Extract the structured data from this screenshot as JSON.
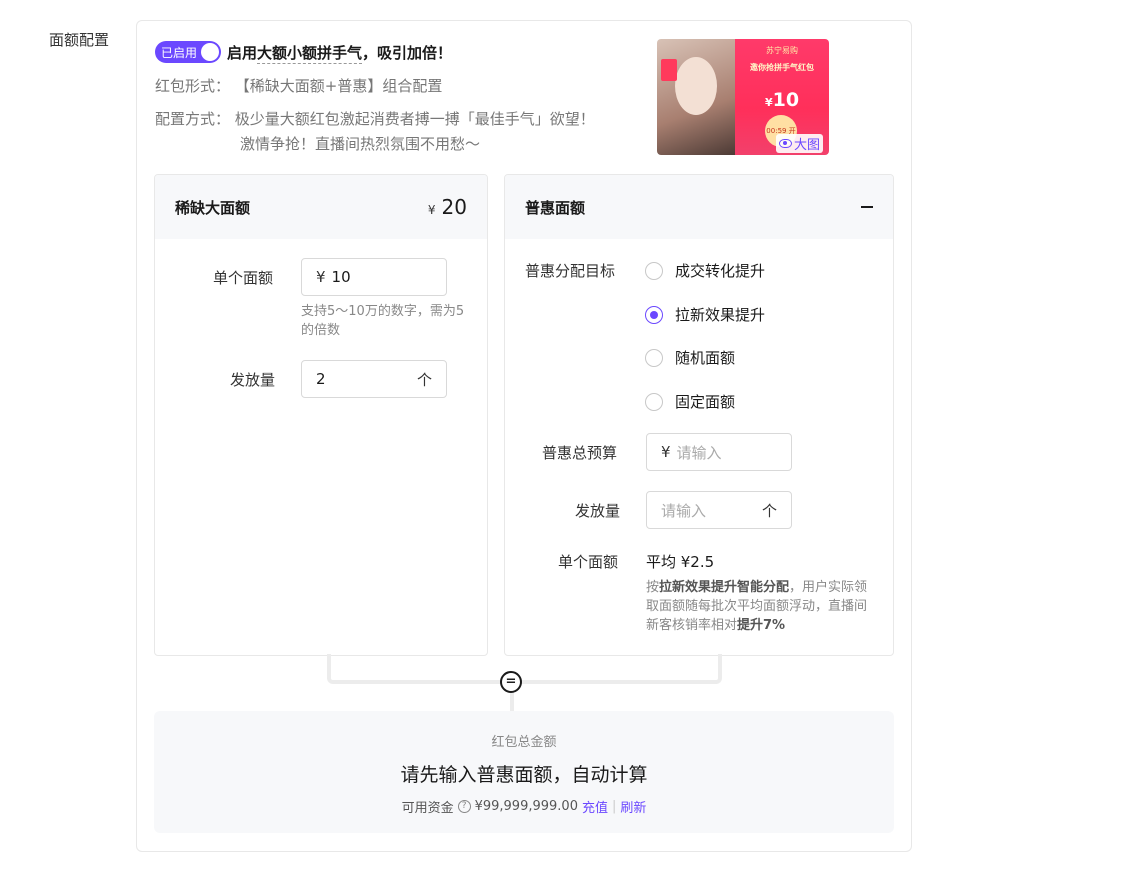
{
  "field_label": "面额配置",
  "header": {
    "toggle_label": "已启用",
    "title_prefix": "启用",
    "title_highlight": "大额小额拼手气",
    "title_suffix": "，吸引加倍！"
  },
  "info": {
    "form_label": "红包形式：",
    "form_value": "【稀缺大面额+普惠】组合配置",
    "method_label": "配置方式：",
    "method_value_1": "极少量大额红包激起消费者搏一搏「最佳手气」欲望！",
    "method_value_2": "激情争抢！直播间热烈氛围不用愁～"
  },
  "preview": {
    "brand": "苏宁易购",
    "banner": "邀你抢拼手气红包",
    "amount_currency": "¥",
    "amount": "10",
    "button": "00:59 开抢",
    "big_label": "大图"
  },
  "scarce": {
    "title": "稀缺大面额",
    "currency": "¥",
    "total": "20",
    "single_label": "单个面额",
    "single_currency": "¥",
    "single_value": "10",
    "hint": "支持5～10万的数字，需为5的倍数",
    "count_label": "发放量",
    "count_value": "2",
    "count_unit": "个"
  },
  "inclusive": {
    "title": "普惠面额",
    "goal_label": "普惠分配目标",
    "options": [
      {
        "label": "成交转化提升",
        "selected": false
      },
      {
        "label": "拉新效果提升",
        "selected": true
      },
      {
        "label": "随机面额",
        "selected": false
      },
      {
        "label": "固定面额",
        "selected": false
      }
    ],
    "budget_label": "普惠总预算",
    "budget_currency": "¥",
    "budget_placeholder": "请输入",
    "count_label": "发放量",
    "count_placeholder": "请输入",
    "count_unit": "个",
    "single_label": "单个面额",
    "single_value": "平均 ¥2.5",
    "hint_prefix": "按",
    "hint_bold": "拉新效果提升智能分配",
    "hint_mid": "，用户实际领取面额随每批次平均面额浮动，直播间新客核销率相对",
    "hint_bold2": "提升7%"
  },
  "total": {
    "equals_symbol": "=",
    "label": "红包总金额",
    "main": "请先输入普惠面额，自动计算",
    "funds_label": "可用资金",
    "help_symbol": "?",
    "funds_value": "¥99,999,999.00",
    "recharge": "充值",
    "separator": "|",
    "refresh": "刷新"
  },
  "colors": {
    "accent": "#6b48ff",
    "panel_bg": "#f7f8fa",
    "border": "#e8e8e8"
  }
}
